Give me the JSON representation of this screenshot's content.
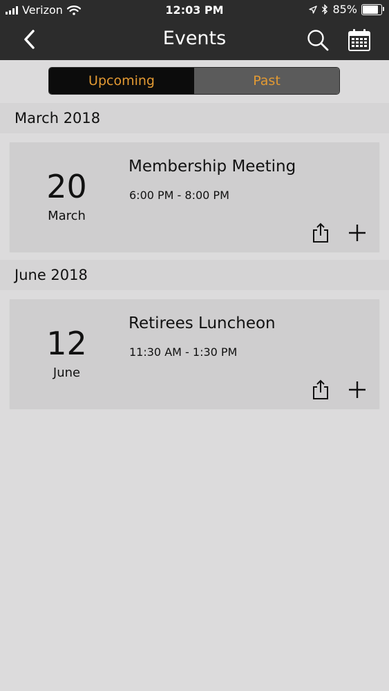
{
  "status_bar": {
    "carrier": "Verizon",
    "time": "12:03 PM",
    "battery": "85%",
    "battery_level": 0.85
  },
  "nav": {
    "title": "Events",
    "back_icon": "chevron-left-icon",
    "search_icon": "search-icon",
    "calendar_icon": "calendar-icon"
  },
  "tabs": [
    {
      "label": "Upcoming",
      "selected": true
    },
    {
      "label": "Past",
      "selected": false
    }
  ],
  "accent_color": "#e39a33",
  "sections": [
    {
      "month_label": "March 2018",
      "events": [
        {
          "day": "20",
          "month": "March",
          "title": "Membership Meeting",
          "time": "6:00 PM - 8:00 PM"
        }
      ]
    },
    {
      "month_label": "June 2018",
      "events": [
        {
          "day": "12",
          "month": "June",
          "title": "Retirees Luncheon",
          "time": "11:30 AM - 1:30 PM"
        }
      ]
    }
  ]
}
